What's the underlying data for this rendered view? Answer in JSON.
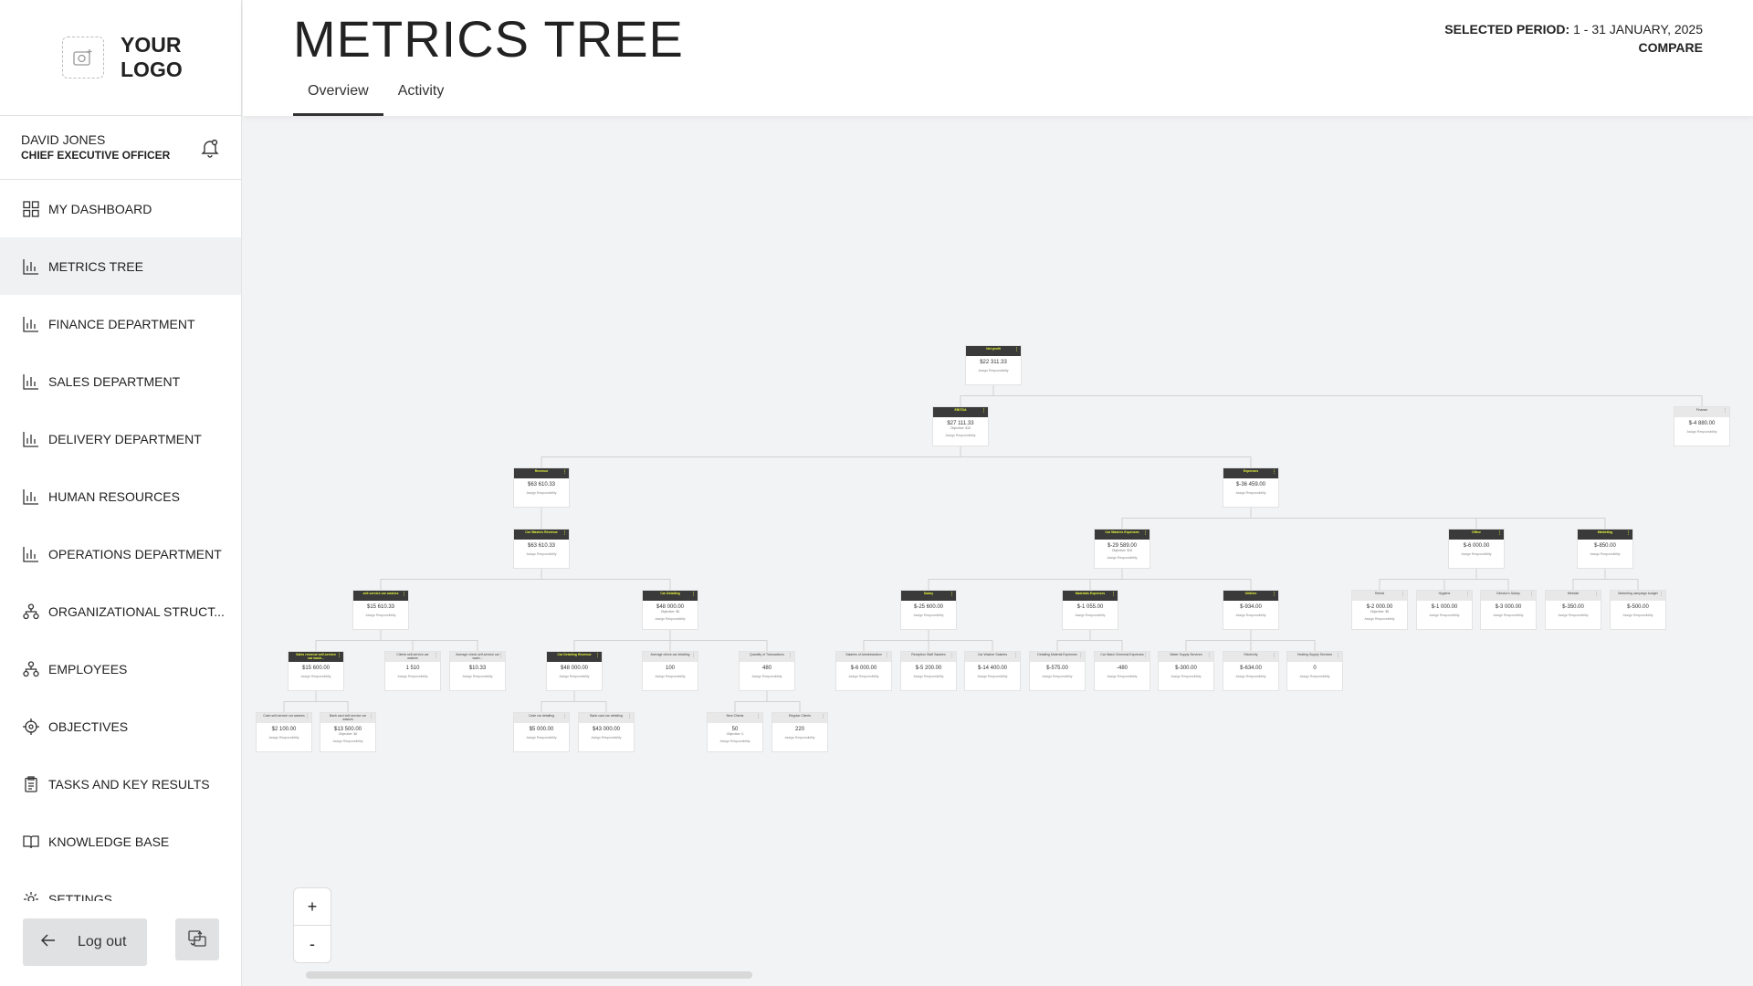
{
  "app": {
    "logo_text": "YOUR\nLOGO",
    "logo_icon": "image-add-icon",
    "accent_color": "#e6f53a"
  },
  "user": {
    "name": "DAVID JONES",
    "role": "CHIEF EXECUTIVE OFFICER"
  },
  "sidebar": {
    "items": [
      {
        "label": "MY DASHBOARD",
        "icon": "dashboard-grid-icon"
      },
      {
        "label": "METRICS TREE",
        "icon": "bar-chart-icon",
        "active": true
      },
      {
        "label": "FINANCE DEPARTMENT",
        "icon": "bar-chart-icon"
      },
      {
        "label": "SALES DEPARTMENT",
        "icon": "bar-chart-icon"
      },
      {
        "label": "DELIVERY DEPARTMENT",
        "icon": "bar-chart-icon"
      },
      {
        "label": "HUMAN RESOURCES",
        "icon": "bar-chart-icon"
      },
      {
        "label": "OPERATIONS DEPARTMENT",
        "icon": "bar-chart-icon"
      },
      {
        "label": "ORGANIZATIONAL STRUCT...",
        "icon": "org-structure-icon"
      },
      {
        "label": "EMPLOYEES",
        "icon": "org-structure-icon"
      },
      {
        "label": "OBJECTIVES",
        "icon": "target-icon"
      },
      {
        "label": "TASKS AND KEY RESULTS",
        "icon": "clipboard-icon"
      },
      {
        "label": "KNOWLEDGE BASE",
        "icon": "book-icon"
      },
      {
        "label": "SETTINGS",
        "icon": "gear-icon"
      }
    ],
    "logout_label": "Log out"
  },
  "header": {
    "title": "METRICS TREE",
    "tabs": [
      {
        "label": "Overview",
        "active": true
      },
      {
        "label": "Activity"
      }
    ],
    "period_label": "SELECTED PERIOD:",
    "period_value": "1 - 31 JANUARY, 2025",
    "compare_label": "COMPARE"
  },
  "zoom": {
    "in_label": "+",
    "out_label": "-"
  },
  "tree": {
    "assign_label": "Assign Responsibility",
    "nodes": [
      {
        "id": "net-profit",
        "title": "Net profit",
        "value": "$22 311.33",
        "dark": true
      },
      {
        "id": "ebitda",
        "title": "EBITDA",
        "value": "$27 111.33",
        "sub": "Objective: $10",
        "dark": true
      },
      {
        "id": "finance",
        "title": "Finance",
        "value": "$-4 880.00"
      },
      {
        "id": "revenue",
        "title": "Revenue",
        "value": "$63 610.33",
        "dark": true
      },
      {
        "id": "expenses",
        "title": "Expenses",
        "value": "$-36 459.00",
        "dark": true
      },
      {
        "id": "car-wash-revenue",
        "title": "Car Washes Revenue",
        "value": "$63 610.33",
        "dark": true
      },
      {
        "id": "car-wash-expenses",
        "title": "Car Washes Expenses",
        "value": "$-29 589.00",
        "sub": "Objective: $10",
        "dark": true
      },
      {
        "id": "office",
        "title": "Office",
        "value": "$-6 000.00",
        "dark": true
      },
      {
        "id": "marketing",
        "title": "Marketing",
        "value": "$-850.00",
        "dark": true
      },
      {
        "id": "self-service",
        "title": "self-service car washes",
        "value": "$15 610.33",
        "dark": true
      },
      {
        "id": "car-detailing",
        "title": "Car Detailing",
        "value": "$48 000.00",
        "sub": "Objective: $0",
        "dark": true
      },
      {
        "id": "salary",
        "title": "Salary",
        "value": "$-25 600.00",
        "dark": true
      },
      {
        "id": "materials",
        "title": "Materials Expenses",
        "value": "$-1 055.00",
        "dark": true
      },
      {
        "id": "utilities",
        "title": "Utilities",
        "value": "$-934.00",
        "dark": true
      },
      {
        "id": "rental",
        "title": "Rental",
        "value": "$-2 000.00",
        "sub": "Objective: $0"
      },
      {
        "id": "hygiene",
        "title": "Hygiene",
        "value": "$-1 000.00"
      },
      {
        "id": "directors-salary",
        "title": "Director's Salary",
        "value": "$-3 000.00"
      },
      {
        "id": "website",
        "title": "Website",
        "value": "$-350.00"
      },
      {
        "id": "mkt-budget",
        "title": "Marketing campaign budget",
        "value": "$-500.00"
      },
      {
        "id": "sales-revenue",
        "title": "Sales revenue self-service car wash...",
        "value": "$15 600.00",
        "dark": true
      },
      {
        "id": "clients-self",
        "title": "Clients self-service car washes",
        "value": "1 510"
      },
      {
        "id": "avg-check-self",
        "title": "Average check self-service car wash...",
        "value": "$10.33"
      },
      {
        "id": "detailing-revenue",
        "title": "Car Detailing Revenue",
        "value": "$48 000.00",
        "dark": true
      },
      {
        "id": "avg-check-detailing",
        "title": "Average check car detailing",
        "value": "100"
      },
      {
        "id": "qty-transactions",
        "title": "Quantity of Transactions",
        "value": "480"
      },
      {
        "id": "salaries-admin",
        "title": "Salaries of Administration",
        "value": "$-6 000.00"
      },
      {
        "id": "reception-staff",
        "title": "Reception Staff Salaries",
        "value": "$-5 200.00"
      },
      {
        "id": "car-washer",
        "title": "Car Washer Salaries",
        "value": "$-14 400.00"
      },
      {
        "id": "detailing-material",
        "title": "Detailing Material Expenses",
        "value": "$-575.00"
      },
      {
        "id": "car-wash-chemical",
        "title": "Car Wash Chemical Expenses",
        "value": "-480"
      },
      {
        "id": "water-supply",
        "title": "Water Supply Services",
        "value": "$-300.00"
      },
      {
        "id": "electricity",
        "title": "Electricity",
        "value": "$-634.00"
      },
      {
        "id": "heating-supply",
        "title": "Heating Supply Services",
        "value": "0"
      },
      {
        "id": "cash-self",
        "title": "Cash self-service car washes",
        "value": "$2 100.00"
      },
      {
        "id": "bank-self",
        "title": "Bank card self-service car washes",
        "value": "$13 500.00",
        "sub": "Objective: $0"
      },
      {
        "id": "cash-detailing",
        "title": "Cash car detailing",
        "value": "$5 000.00"
      },
      {
        "id": "bank-detailing",
        "title": "Bank card car detailing",
        "value": "$43 000.00"
      },
      {
        "id": "new-clients",
        "title": "New Clients",
        "value": "50",
        "sub": "Objective: 0"
      },
      {
        "id": "regular-clients",
        "title": "Regular Clients",
        "value": "220"
      }
    ],
    "edges": [
      [
        "net-profit",
        "ebitda"
      ],
      [
        "net-profit",
        "finance"
      ],
      [
        "ebitda",
        "revenue"
      ],
      [
        "ebitda",
        "expenses"
      ],
      [
        "revenue",
        "car-wash-revenue"
      ],
      [
        "expenses",
        "car-wash-expenses"
      ],
      [
        "expenses",
        "office"
      ],
      [
        "expenses",
        "marketing"
      ],
      [
        "car-wash-revenue",
        "self-service"
      ],
      [
        "car-wash-revenue",
        "car-detailing"
      ],
      [
        "car-wash-expenses",
        "salary"
      ],
      [
        "car-wash-expenses",
        "materials"
      ],
      [
        "car-wash-expenses",
        "utilities"
      ],
      [
        "office",
        "rental"
      ],
      [
        "office",
        "hygiene"
      ],
      [
        "office",
        "directors-salary"
      ],
      [
        "marketing",
        "website"
      ],
      [
        "marketing",
        "mkt-budget"
      ],
      [
        "self-service",
        "sales-revenue"
      ],
      [
        "self-service",
        "clients-self"
      ],
      [
        "self-service",
        "avg-check-self"
      ],
      [
        "car-detailing",
        "detailing-revenue"
      ],
      [
        "car-detailing",
        "avg-check-detailing"
      ],
      [
        "car-detailing",
        "qty-transactions"
      ],
      [
        "salary",
        "salaries-admin"
      ],
      [
        "salary",
        "reception-staff"
      ],
      [
        "salary",
        "car-washer"
      ],
      [
        "materials",
        "detailing-material"
      ],
      [
        "materials",
        "car-wash-chemical"
      ],
      [
        "utilities",
        "water-supply"
      ],
      [
        "utilities",
        "electricity"
      ],
      [
        "utilities",
        "heating-supply"
      ],
      [
        "sales-revenue",
        "cash-self"
      ],
      [
        "sales-revenue",
        "bank-self"
      ],
      [
        "detailing-revenue",
        "cash-detailing"
      ],
      [
        "detailing-revenue",
        "bank-detailing"
      ],
      [
        "qty-transactions",
        "new-clients"
      ],
      [
        "qty-transactions",
        "regular-clients"
      ]
    ]
  }
}
